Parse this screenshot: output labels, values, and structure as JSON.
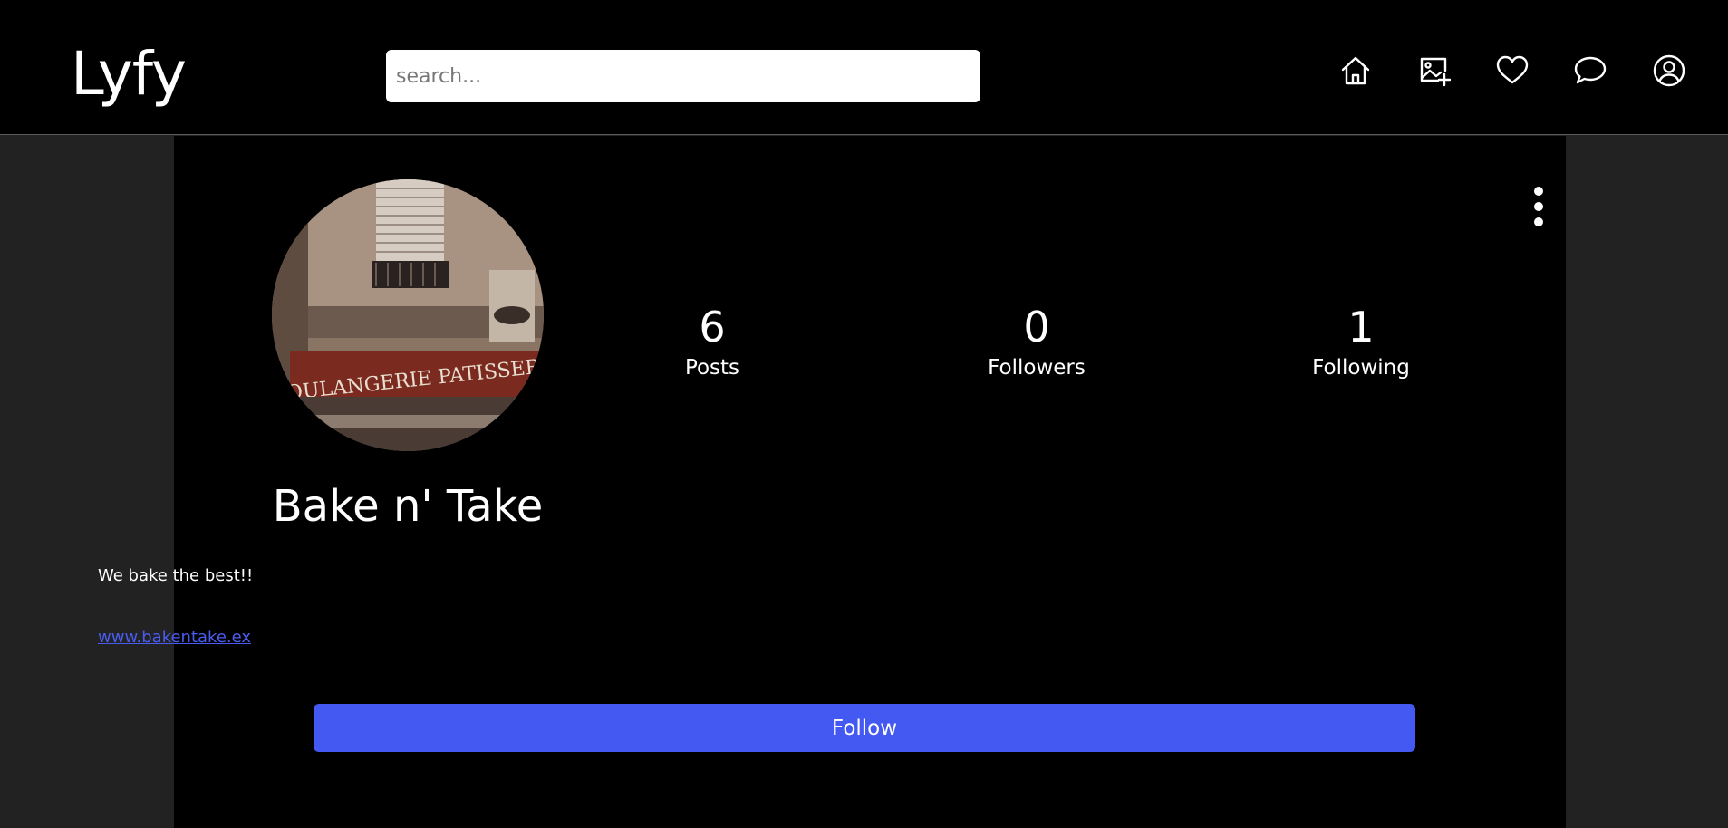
{
  "app": {
    "logo": "Lyfy"
  },
  "search": {
    "placeholder": "search..."
  },
  "nav": [
    {
      "name": "home-icon"
    },
    {
      "name": "add-image-icon"
    },
    {
      "name": "heart-icon"
    },
    {
      "name": "chat-bubble-icon"
    },
    {
      "name": "user-profile-icon"
    }
  ],
  "profile": {
    "name": "Bake n' Take",
    "bio": "We bake the best!!",
    "website": "www.bakentake.ex",
    "avatar_text": "BOULANGERIE PATISSERIE",
    "stats": {
      "posts": {
        "count": "6",
        "label": "Posts"
      },
      "followers": {
        "count": "0",
        "label": "Followers"
      },
      "following": {
        "count": "1",
        "label": "Following"
      }
    },
    "follow_label": "Follow"
  },
  "colors": {
    "accent": "#4458f2",
    "link": "#4a5cf0",
    "background": "#222222",
    "panel": "#000000"
  }
}
